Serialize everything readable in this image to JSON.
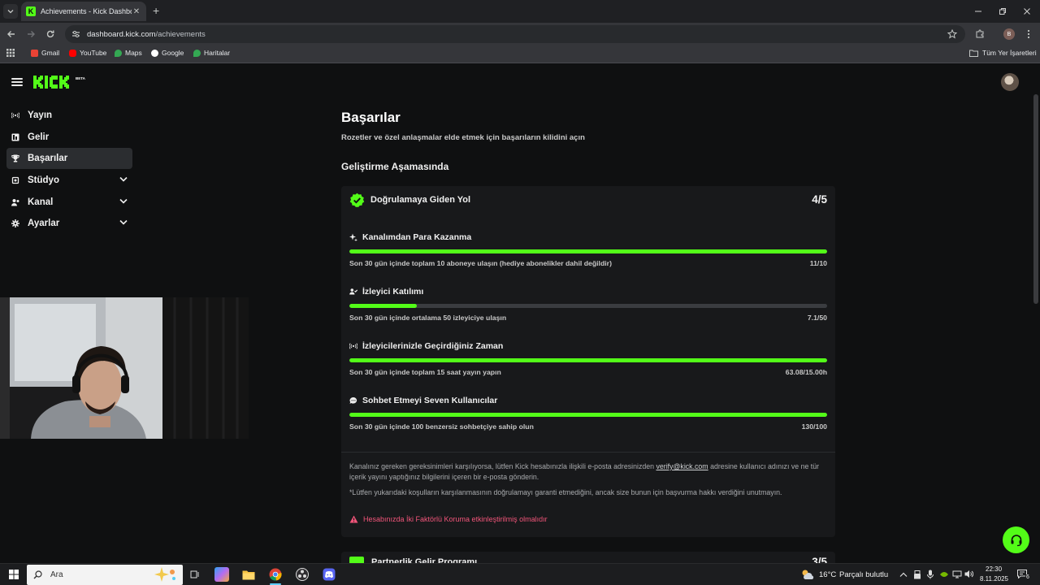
{
  "browser": {
    "tab_title": "Achievements - Kick Dashboard",
    "tab_favicon_letter": "K",
    "new_tab_symbol": "+",
    "url_host": "dashboard.kick.com",
    "url_path": "/achievements",
    "profile_letter": "B",
    "bookmarks": [
      "Gmail",
      "YouTube",
      "Maps",
      "Google",
      "Haritalar"
    ],
    "all_bookmarks": "Tüm Yer İşaretleri"
  },
  "app": {
    "accent": "#53fc18",
    "sidebar": {
      "items": [
        {
          "label": "Yayın",
          "icon": "broadcast-icon",
          "expandable": false,
          "active": false
        },
        {
          "label": "Gelir",
          "icon": "revenue-icon",
          "expandable": false,
          "active": false
        },
        {
          "label": "Başarılar",
          "icon": "trophy-icon",
          "expandable": false,
          "active": true
        },
        {
          "label": "Stüdyo",
          "icon": "studio-icon",
          "expandable": true,
          "active": false
        },
        {
          "label": "Kanal",
          "icon": "channel-icon",
          "expandable": true,
          "active": false
        },
        {
          "label": "Ayarlar",
          "icon": "settings-icon",
          "expandable": true,
          "active": false
        }
      ]
    },
    "page": {
      "title": "Başarılar",
      "subtitle": "Rozetler ve özel anlaşmalar elde etmek için başarıların kilidini açın",
      "section": "Geliştirme Aşamasında"
    },
    "card": {
      "title": "Doğrulamaya Giden Yol",
      "score": "4/5",
      "requirements": [
        {
          "title": "Kanalımdan Para Kazanma",
          "icon": "sparkle-icon",
          "desc": "Son 30 gün içinde toplam 10 aboneye ulaşın (hediye abonelikler dahil değildir)",
          "value": "11/10",
          "progress": 1.0
        },
        {
          "title": "İzleyici Katılımı",
          "icon": "viewers-icon",
          "desc": "Son 30 gün içinde ortalama 50 izleyiciye ulaşın",
          "value": "7.1/50",
          "progress": 0.142
        },
        {
          "title": "İzleyicilerinizle Geçirdiğiniz Zaman",
          "icon": "broadcast-icon",
          "desc": "Son 30 gün içinde toplam 15 saat yayın yapın",
          "value": "63.08/15.00h",
          "progress": 1.0
        },
        {
          "title": "Sohbet Etmeyi Seven Kullanıcılar",
          "icon": "chat-icon",
          "desc": "Son 30 gün içinde 100 benzersiz sohbetçiye sahip olun",
          "value": "130/100",
          "progress": 1.0
        }
      ],
      "note1_before": "Kanalınız gereken gereksinimleri karşılıyorsa, lütfen Kick hesabınızla ilişkili e-posta adresinizden ",
      "note1_link": "verify@kick.com",
      "note1_after": " adresine kullanıcı adınızı ve ne tür içerik yayını yaptığınız bilgilerini içeren bir e-posta gönderin.",
      "note2": "*Lütfen yukarıdaki koşulların karşılanmasının doğrulamayı garanti etmediğini, ancak size bunun için başvurma hakkı verdiğini unutmayın.",
      "warning": "Hesabınızda İki Faktörlü Koruma etkinleştirilmiş olmalıdır"
    },
    "card2": {
      "title": "Partnerlik Gelir Programı",
      "score": "3/5"
    }
  },
  "taskbar": {
    "search_placeholder": "Ara",
    "weather_temp": "16°C",
    "weather_desc": "Parçalı bulutlu",
    "time": "22:30",
    "date": "8.11.2025",
    "notification_count": "6"
  }
}
